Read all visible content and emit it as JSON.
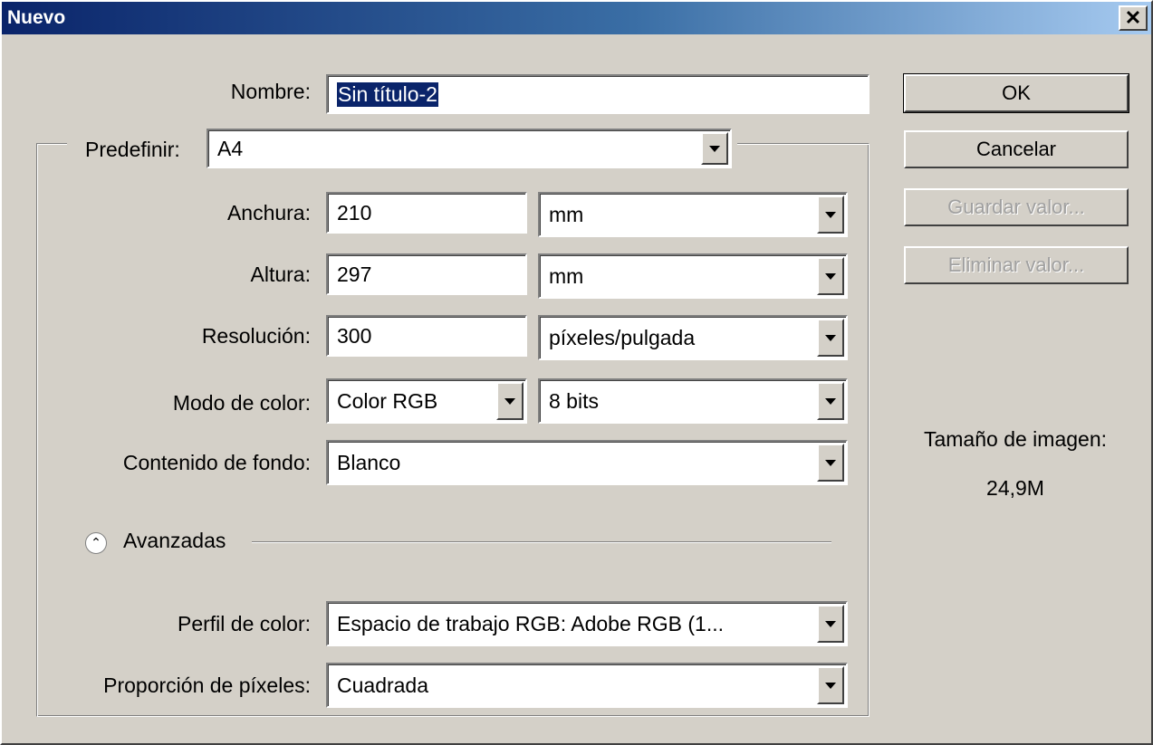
{
  "window": {
    "title": "Nuevo",
    "close_glyph": "✕"
  },
  "form": {
    "name_label": "Nombre:",
    "name_value": "Sin título-2",
    "preset_label": "Predefinir:",
    "preset_value": "A4",
    "width_label": "Anchura:",
    "width_value": "210",
    "width_unit": "mm",
    "height_label": "Altura:",
    "height_value": "297",
    "height_unit": "mm",
    "resolution_label": "Resolución:",
    "resolution_value": "300",
    "resolution_unit": "píxeles/pulgada",
    "color_mode_label": "Modo de color:",
    "color_mode_value": "Color RGB",
    "bit_depth_value": "8 bits",
    "background_label": "Contenido de fondo:",
    "background_value": "Blanco",
    "advanced_label": "Avanzadas",
    "advanced_icon": "chevron-up-double-icon",
    "color_profile_label": "Perfil de color:",
    "color_profile_value": "Espacio de trabajo RGB: Adobe RGB (1...",
    "pixel_aspect_label": "Proporción de píxeles:",
    "pixel_aspect_value": "Cuadrada"
  },
  "buttons": {
    "ok": "OK",
    "cancel": "Cancelar",
    "save_preset": "Guardar valor...",
    "delete_preset": "Eliminar valor..."
  },
  "image_size": {
    "label": "Tamaño de imagen:",
    "value": "24,9M"
  },
  "colors": {
    "title_start": "#0a246a",
    "title_end": "#a6caf0",
    "dialog_bg": "#d4d0c8",
    "selection": "#0a246a"
  }
}
